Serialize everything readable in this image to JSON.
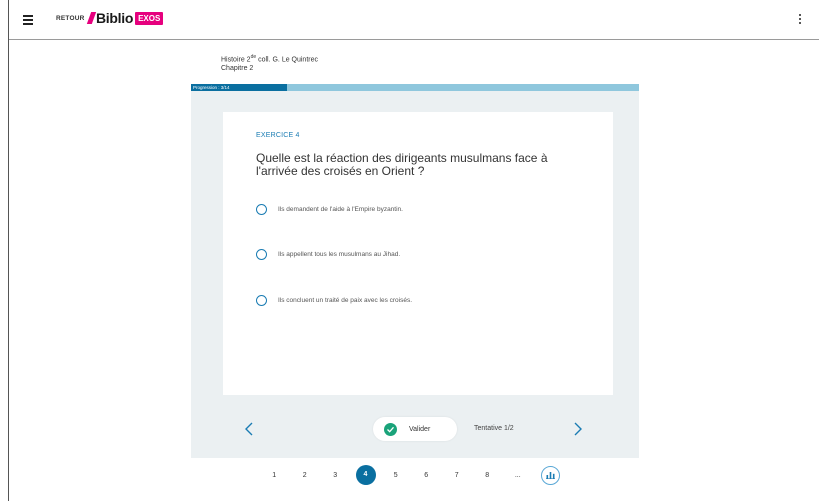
{
  "topbar": {
    "back_label": "RETOUR",
    "logo_main": "Biblio",
    "logo_tag": "EXOS"
  },
  "book": {
    "title_pre": "Histoire 2",
    "title_sup": "de",
    "title_post": " coll. G. Le Quintrec",
    "chapter": "Chapitre 2"
  },
  "progress": {
    "label": "Progression : 3/14",
    "current": 3,
    "total": 14
  },
  "exercise": {
    "label": "EXERCICE 4",
    "question": "Quelle est la réaction des dirigeants musulmans face à l'arrivée des croisés en Orient ?",
    "options": [
      "Ils demandent de l'aide à l'Empire byzantin.",
      "Ils appellent tous les musulmans au Jihad.",
      "Ils concluent un traité de paix avec les croisés."
    ]
  },
  "actions": {
    "validate_label": "Valider",
    "attempt": "Tentative 1/2"
  },
  "pager": {
    "pages": [
      "1",
      "2",
      "3",
      "4",
      "5",
      "6",
      "7",
      "8",
      "..."
    ],
    "current": "4"
  },
  "colors": {
    "accent": "#0a6fa0",
    "brand": "#e6007e",
    "success": "#1aa37a"
  }
}
